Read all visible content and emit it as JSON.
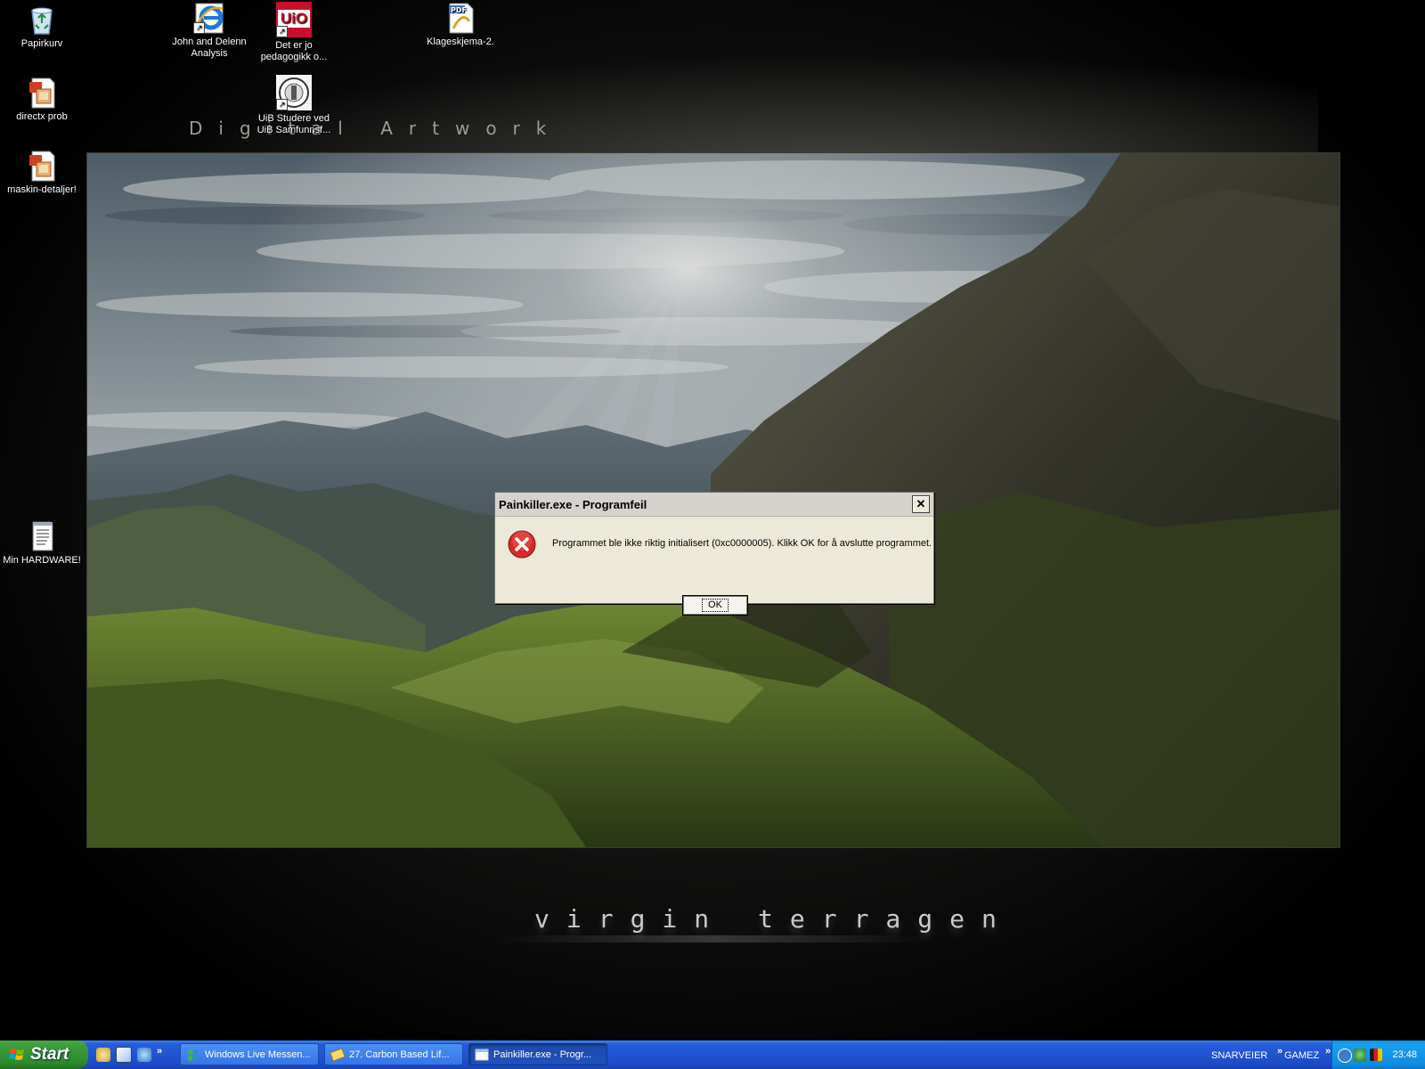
{
  "wallpaper": {
    "caption_top": "Digital Artwork",
    "caption_bottom": "virgin terragen"
  },
  "desktop_icons": [
    {
      "label": "Papirkurv",
      "icon": "recycle-bin-icon"
    },
    {
      "label": "John and Delenn Analysis",
      "icon": "internet-explorer-icon"
    },
    {
      "label": "Det er jo pedagogikk o...",
      "icon": "uio-logo-icon"
    },
    {
      "label": "Klageskjema-2.",
      "icon": "pdf-document-icon"
    },
    {
      "label": "directx prob",
      "icon": "image-document-icon"
    },
    {
      "label": "UiB  Studere ved UiB  Samfunnsf...",
      "icon": "uib-seal-icon"
    },
    {
      "label": "maskin-detaljer!",
      "icon": "image-document-icon"
    },
    {
      "label": "Min HARDWARE!",
      "icon": "text-document-icon"
    }
  ],
  "uio_logo_text": "UiO",
  "dialog": {
    "title": "Painkiller.exe - Programfeil",
    "message": "Programmet ble ikke riktig initialisert (0xc0000005). Klikk OK for å avslutte programmet.",
    "ok_label": "OK",
    "close_label": "✕",
    "icon": "error-icon"
  },
  "taskbar": {
    "start_label": "Start",
    "quick_launch_chevron": "»",
    "tasks": [
      {
        "label": "Windows Live Messen...",
        "icon": "messenger-icon",
        "active": false
      },
      {
        "label": "27. Carbon Based Lif...",
        "icon": "media-file-icon",
        "active": false
      },
      {
        "label": "Painkiller.exe - Progr...",
        "icon": "window-icon",
        "active": true
      }
    ],
    "toolbar_snarveier": "SNARVEIER",
    "toolbar_gamez": "GAMEZ",
    "toolbar_chevron": "»",
    "clock": "23:48"
  },
  "colors": {
    "taskbar_blue": "#245edb",
    "start_green": "#3c9d3c",
    "tray_blue": "#0f8be0",
    "dialog_bg": "#ece9d8",
    "error_red": "#d62a2a"
  }
}
